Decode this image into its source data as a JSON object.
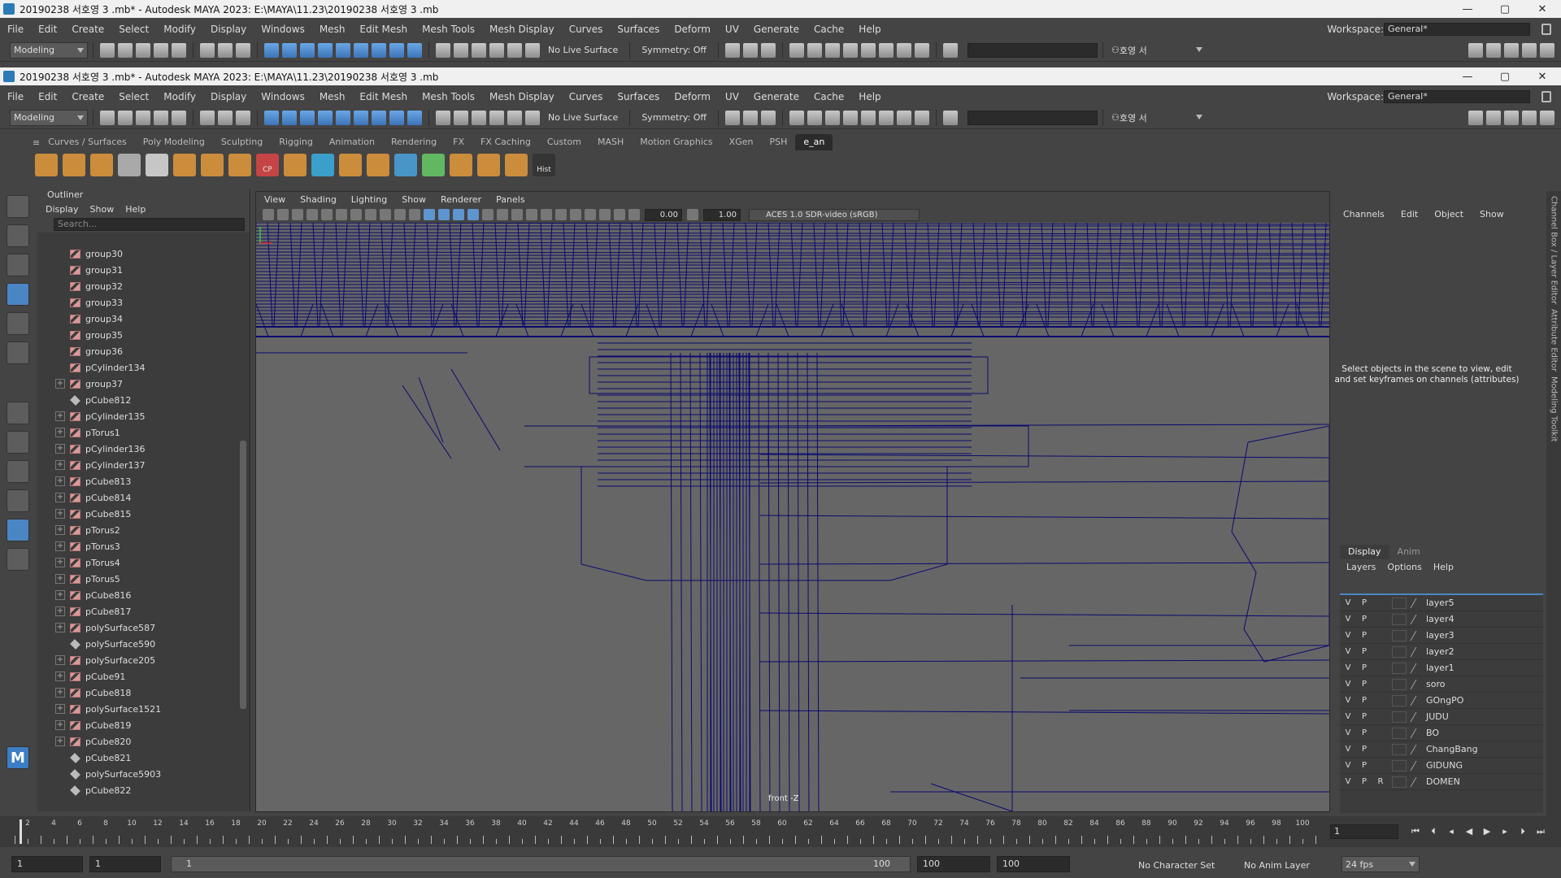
{
  "window_title": "20190238 서호영 3 .mb* - Autodesk MAYA 2023: E:\\MAYA\\11.23\\20190238 서호영 3 .mb",
  "window_title_top": "20190238 서호영 3 .mb* - Autodesk MAYA 2023: E:\\MAYA\\11.23\\20190238 서호영 3 .mb",
  "window_controls": {
    "minimize": "—",
    "maximize": "▢",
    "close": "✕"
  },
  "menus": [
    "File",
    "Edit",
    "Create",
    "Select",
    "Modify",
    "Display",
    "Windows",
    "Mesh",
    "Edit Mesh",
    "Mesh Tools",
    "Mesh Display",
    "Curves",
    "Surfaces",
    "Deform",
    "UV",
    "Generate",
    "Cache",
    "Help"
  ],
  "workspace": {
    "label": "Workspace:",
    "value": "General*"
  },
  "statusline": {
    "mode": "Modeling",
    "live_surface": "No Live Surface",
    "symmetry": "Symmetry: Off",
    "user": "호영 서"
  },
  "shelf_tabs": [
    "Curves / Surfaces",
    "Poly Modeling",
    "Sculpting",
    "Rigging",
    "Animation",
    "Rendering",
    "FX",
    "FX Caching",
    "Custom",
    "MASH",
    "Motion Graphics",
    "XGen",
    "PSH",
    "e_an"
  ],
  "shelf_active": "e_an",
  "shelf_labels": {
    "cp": "CP",
    "hist": "Hist"
  },
  "outliner": {
    "title": "Outliner",
    "menu": [
      "Display",
      "Show",
      "Help"
    ],
    "search_placeholder": "Search...",
    "items": [
      {
        "name": "group30",
        "type": "group",
        "expand": ""
      },
      {
        "name": "group31",
        "type": "group",
        "expand": ""
      },
      {
        "name": "group32",
        "type": "group",
        "expand": ""
      },
      {
        "name": "group33",
        "type": "group",
        "expand": ""
      },
      {
        "name": "group34",
        "type": "group",
        "expand": ""
      },
      {
        "name": "group35",
        "type": "group",
        "expand": ""
      },
      {
        "name": "group36",
        "type": "group",
        "expand": ""
      },
      {
        "name": "pCylinder134",
        "type": "group",
        "expand": ""
      },
      {
        "name": "group37",
        "type": "group",
        "expand": "+"
      },
      {
        "name": "pCube812",
        "type": "mesh",
        "expand": ""
      },
      {
        "name": "pCylinder135",
        "type": "group",
        "expand": "+"
      },
      {
        "name": "pTorus1",
        "type": "group",
        "expand": "+"
      },
      {
        "name": "pCylinder136",
        "type": "group",
        "expand": "+"
      },
      {
        "name": "pCylinder137",
        "type": "group",
        "expand": "+"
      },
      {
        "name": "pCube813",
        "type": "group",
        "expand": "+"
      },
      {
        "name": "pCube814",
        "type": "group",
        "expand": "+"
      },
      {
        "name": "pCube815",
        "type": "group",
        "expand": "+"
      },
      {
        "name": "pTorus2",
        "type": "group",
        "expand": "+"
      },
      {
        "name": "pTorus3",
        "type": "group",
        "expand": "+"
      },
      {
        "name": "pTorus4",
        "type": "group",
        "expand": "+"
      },
      {
        "name": "pTorus5",
        "type": "group",
        "expand": "+"
      },
      {
        "name": "pCube816",
        "type": "group",
        "expand": "+"
      },
      {
        "name": "pCube817",
        "type": "group",
        "expand": "+"
      },
      {
        "name": "polySurface587",
        "type": "group",
        "expand": "+"
      },
      {
        "name": "polySurface590",
        "type": "mesh",
        "expand": ""
      },
      {
        "name": "polySurface205",
        "type": "group",
        "expand": "+"
      },
      {
        "name": "pCube91",
        "type": "group",
        "expand": "+"
      },
      {
        "name": "pCube818",
        "type": "group",
        "expand": "+"
      },
      {
        "name": "polySurface1521",
        "type": "group",
        "expand": "+"
      },
      {
        "name": "pCube819",
        "type": "group",
        "expand": "+"
      },
      {
        "name": "pCube820",
        "type": "group",
        "expand": "+"
      },
      {
        "name": "pCube821",
        "type": "mesh",
        "expand": ""
      },
      {
        "name": "polySurface5903",
        "type": "mesh",
        "expand": ""
      },
      {
        "name": "pCube822",
        "type": "mesh",
        "expand": ""
      }
    ]
  },
  "viewport": {
    "menu": [
      "View",
      "Shading",
      "Lighting",
      "Show",
      "Renderer",
      "Panels"
    ],
    "exposure": "0.00",
    "gamma": "1.00",
    "color_space": "ACES 1.0 SDR-video (sRGB)",
    "camera": "front -Z",
    "wire_color": "#0a0a6e"
  },
  "channel_box": {
    "menu": [
      "Channels",
      "Edit",
      "Object",
      "Show"
    ],
    "message": "Select objects in the scene to view, edit and set keyframes on channels (attributes)"
  },
  "side_tabs": [
    "Channel Box / Layer Editor",
    "Attribute Editor",
    "Modeling Toolkit"
  ],
  "layer_editor": {
    "tabs": [
      "Display",
      "Anim"
    ],
    "menu": [
      "Layers",
      "Options",
      "Help"
    ],
    "layers": [
      {
        "v": "V",
        "p": "P",
        "r": "",
        "name": "layer5"
      },
      {
        "v": "V",
        "p": "P",
        "r": "",
        "name": "layer4"
      },
      {
        "v": "V",
        "p": "P",
        "r": "",
        "name": "layer3"
      },
      {
        "v": "V",
        "p": "P",
        "r": "",
        "name": "layer2"
      },
      {
        "v": "V",
        "p": "P",
        "r": "",
        "name": "layer1"
      },
      {
        "v": "V",
        "p": "P",
        "r": "",
        "name": "soro"
      },
      {
        "v": "V",
        "p": "P",
        "r": "",
        "name": "GOngPO"
      },
      {
        "v": "V",
        "p": "P",
        "r": "",
        "name": "JUDU"
      },
      {
        "v": "V",
        "p": "P",
        "r": "",
        "name": "BO"
      },
      {
        "v": "V",
        "p": "P",
        "r": "",
        "name": "ChangBang"
      },
      {
        "v": "V",
        "p": "P",
        "r": "",
        "name": "GIDUNG"
      },
      {
        "v": "V",
        "p": "P",
        "r": "R",
        "name": "DOMEN"
      }
    ]
  },
  "timeline": {
    "ticks": [
      "2",
      "4",
      "6",
      "8",
      "10",
      "12",
      "14",
      "16",
      "18",
      "20",
      "22",
      "24",
      "26",
      "28",
      "30",
      "32",
      "34",
      "36",
      "38",
      "40",
      "42",
      "44",
      "46",
      "48",
      "50",
      "52",
      "54",
      "56",
      "58",
      "60",
      "62",
      "64",
      "66",
      "68",
      "70",
      "72",
      "74",
      "76",
      "78",
      "80",
      "82",
      "84",
      "86",
      "88",
      "90",
      "92",
      "94",
      "96",
      "98",
      "100"
    ],
    "current_frame": "1"
  },
  "range": {
    "start": "1",
    "playback_start": "1",
    "bar_start": "1",
    "bar_end": "100",
    "playback_end": "100",
    "end": "100",
    "character_set": "No Character Set",
    "anim_layer": "No Anim Layer",
    "fps": "24 fps"
  }
}
